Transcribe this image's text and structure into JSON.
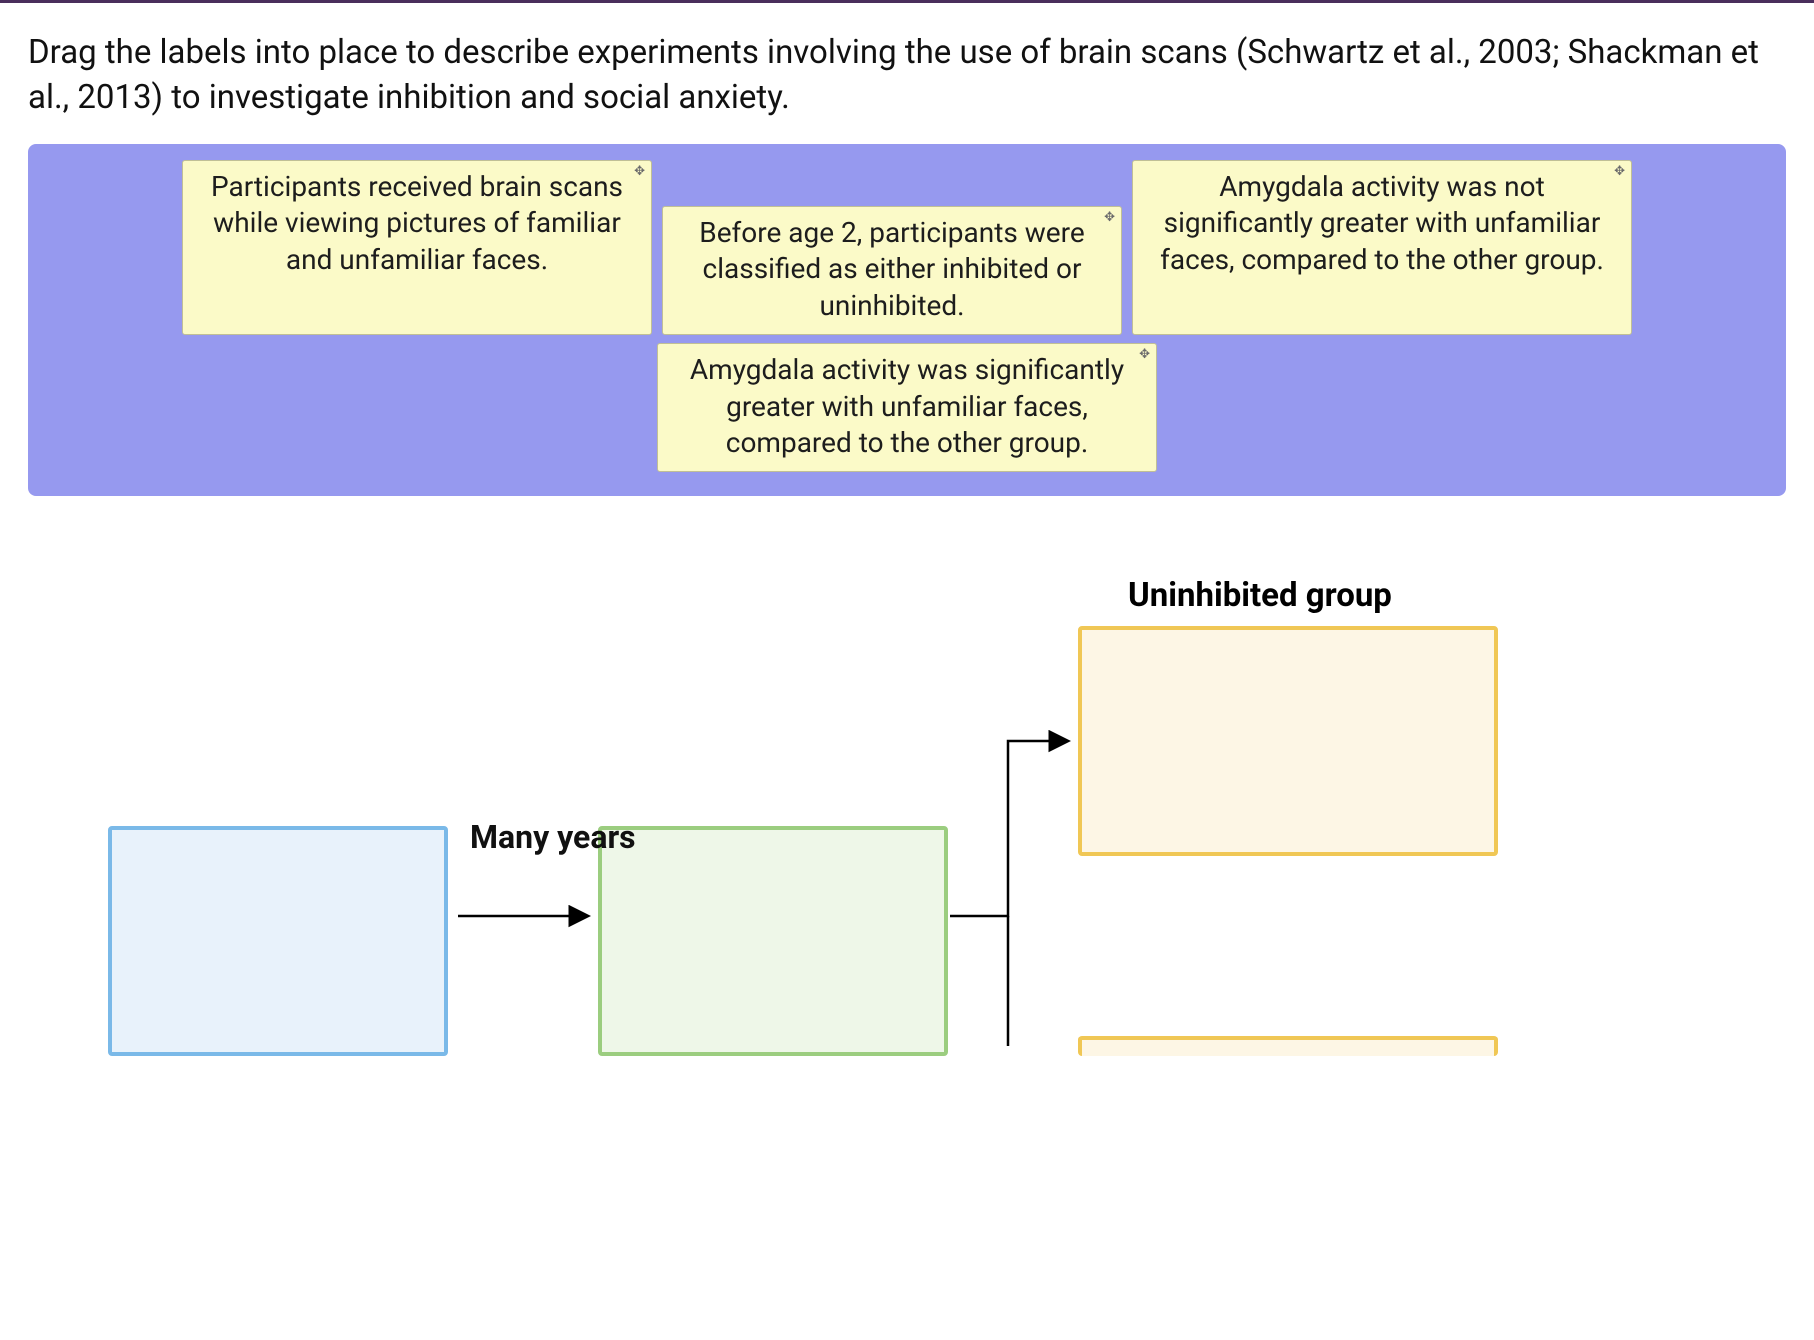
{
  "question": "Drag the labels into place to describe experiments involving the use of brain scans (Schwartz et al., 2003; Shackman et al., 2013) to investigate inhibition and social anxiety.",
  "labels": {
    "l1": "Participants received brain scans while viewing pictures of familiar and unfamiliar faces.",
    "l2": "Before age 2, participants were classified as either inhibited or uninhibited.",
    "l3": "Amygdala activity was not significantly greater with unfamiliar faces, compared to the other group.",
    "l4": "Amygdala activity was significantly greater with unfamiliar faces, compared to the other group."
  },
  "diagram": {
    "heading_uninhibited": "Uninhibited group",
    "arrow_caption": "Many years"
  }
}
